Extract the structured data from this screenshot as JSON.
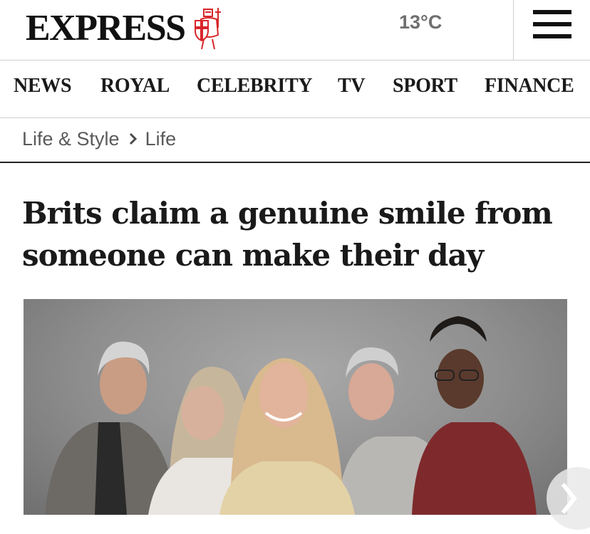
{
  "header": {
    "logo_text": "EXPRESS",
    "logo_icon": "crusader-knight-crest",
    "temperature": "13°C",
    "menu_icon": "hamburger-menu-icon"
  },
  "nav": {
    "items": [
      "NEWS",
      "ROYAL",
      "CELEBRITY",
      "TV",
      "SPORT",
      "FINANCE"
    ]
  },
  "breadcrumb": {
    "items": [
      "Life & Style",
      "Life"
    ],
    "separator_icon": "chevron-right-icon"
  },
  "article": {
    "headline": "Brits claim a genuine smile from someone can make their day"
  },
  "colors": {
    "brand_red": "#d8262a",
    "text_dark": "#1a1a1a",
    "text_grey": "#5a5a5a",
    "divider": "#cfcfcf"
  }
}
